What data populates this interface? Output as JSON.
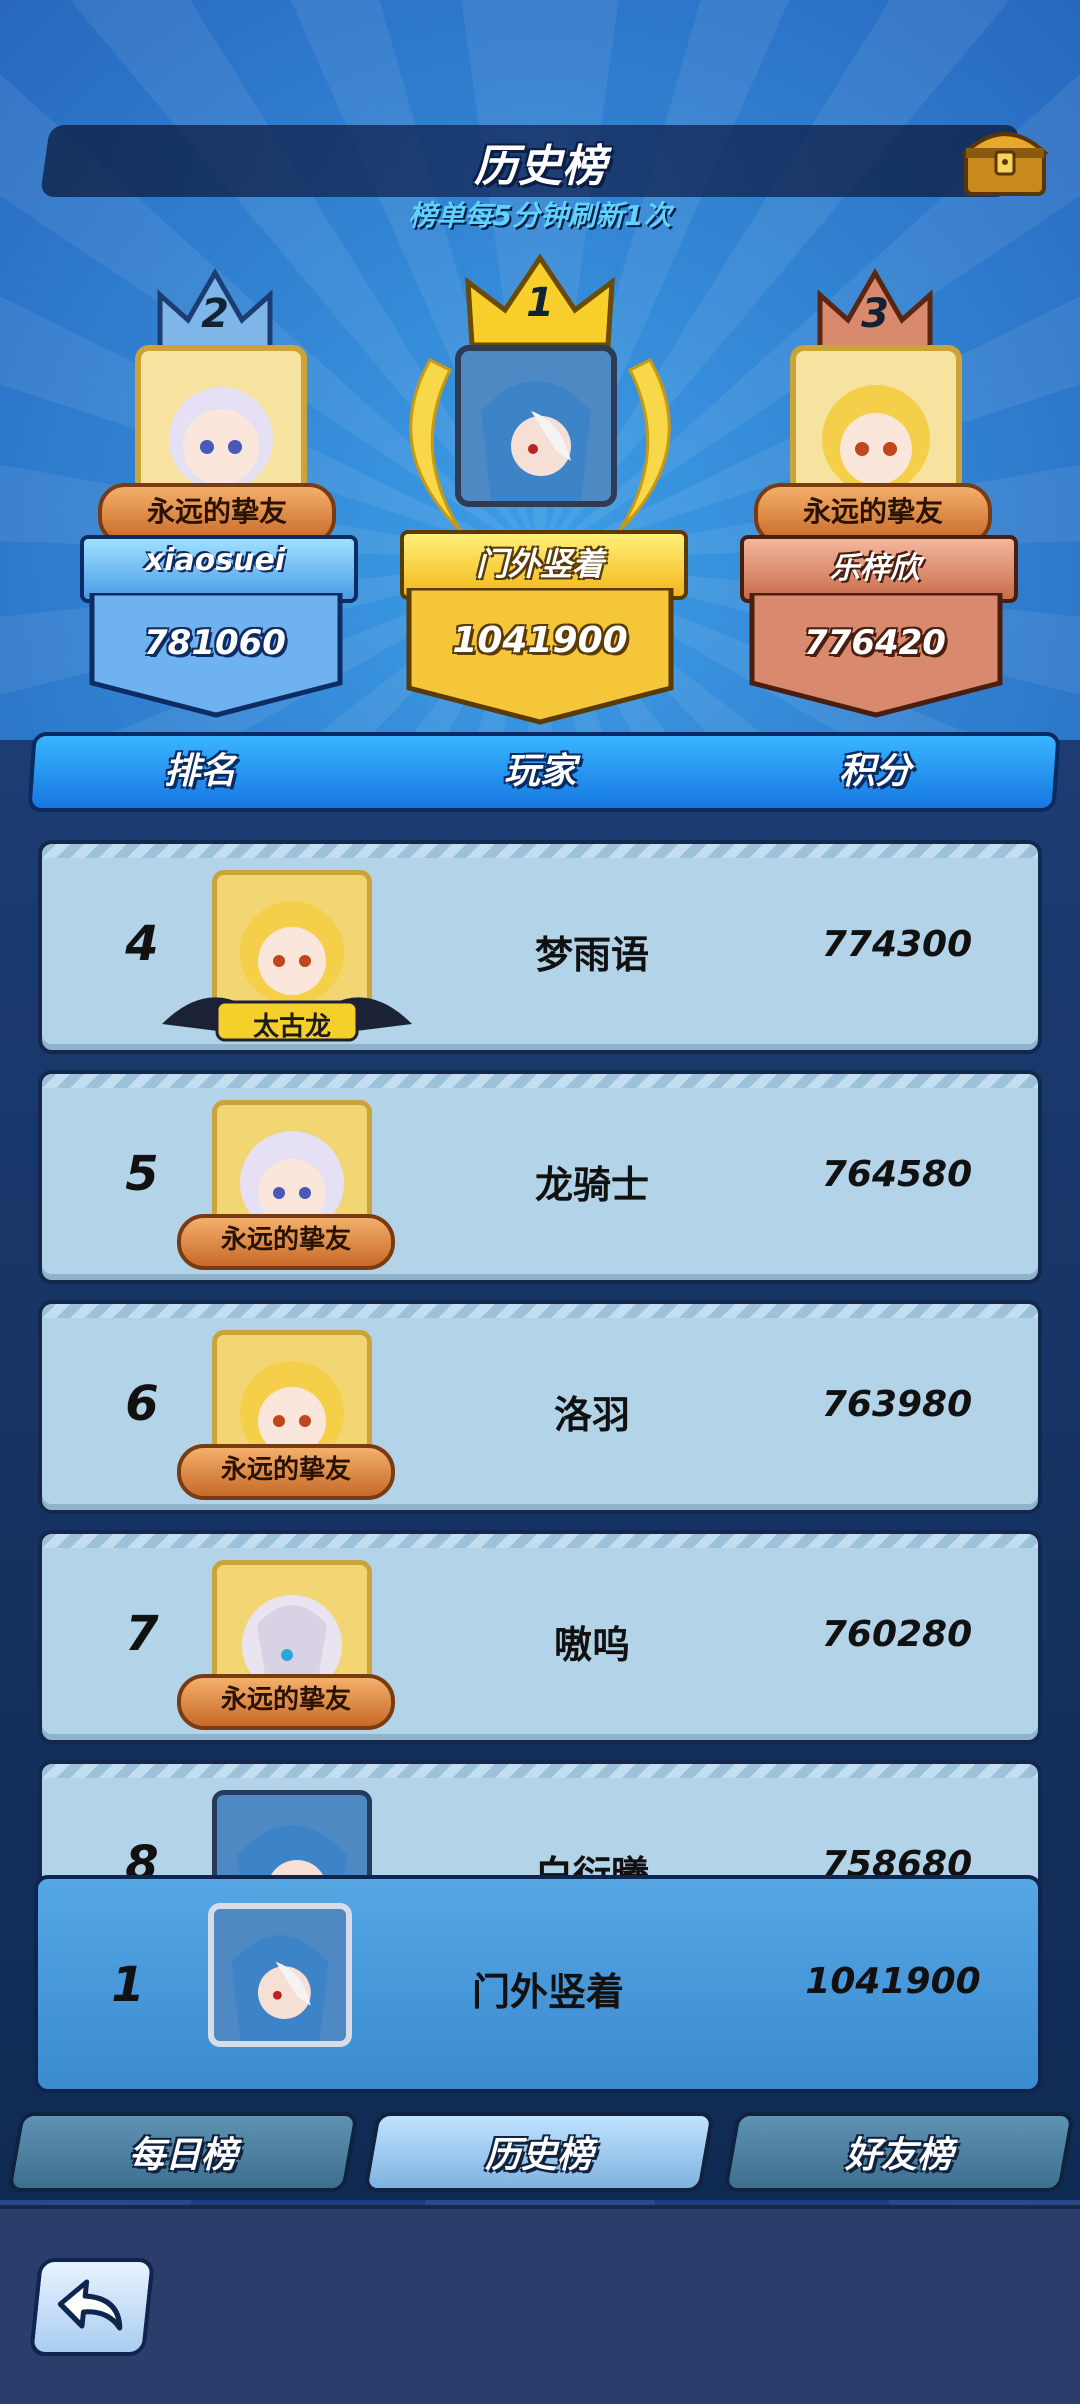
{
  "header": {
    "title": "历史榜",
    "subtitle": "榜单每5分钟刷新1次",
    "chest_icon": "treasure-chest-icon"
  },
  "podium": [
    {
      "rank": "2",
      "title_tag": "永远的挚友",
      "name": "xiaosuei",
      "score": "781060",
      "color": "#6fb2f0"
    },
    {
      "rank": "1",
      "title_tag": "",
      "name": "门外竖着",
      "score": "1041900",
      "color": "#f5c53a"
    },
    {
      "rank": "3",
      "title_tag": "永远的挚友",
      "name": "乐梓欣",
      "score": "776420",
      "color": "#d98a6e"
    }
  ],
  "columns": {
    "rank": "排名",
    "player": "玩家",
    "score": "积分"
  },
  "rows": [
    {
      "rank": "4",
      "tag": "太古龙",
      "name": "梦雨语",
      "score": "774300"
    },
    {
      "rank": "5",
      "tag": "永远的挚友",
      "name": "龙骑士",
      "score": "764580"
    },
    {
      "rank": "6",
      "tag": "永远的挚友",
      "name": "洛羽",
      "score": "763980"
    },
    {
      "rank": "7",
      "tag": "永远的挚友",
      "name": "嗷呜",
      "score": "760280"
    },
    {
      "rank": "8",
      "tag": "",
      "name": "白衍曦",
      "score": "758680"
    }
  ],
  "self": {
    "rank": "1",
    "name": "门外竖着",
    "score": "1041900"
  },
  "tabs": [
    {
      "label": "每日榜",
      "active": false
    },
    {
      "label": "历史榜",
      "active": true
    },
    {
      "label": "好友榜",
      "active": false
    }
  ],
  "back_icon": "back-arrow-icon"
}
